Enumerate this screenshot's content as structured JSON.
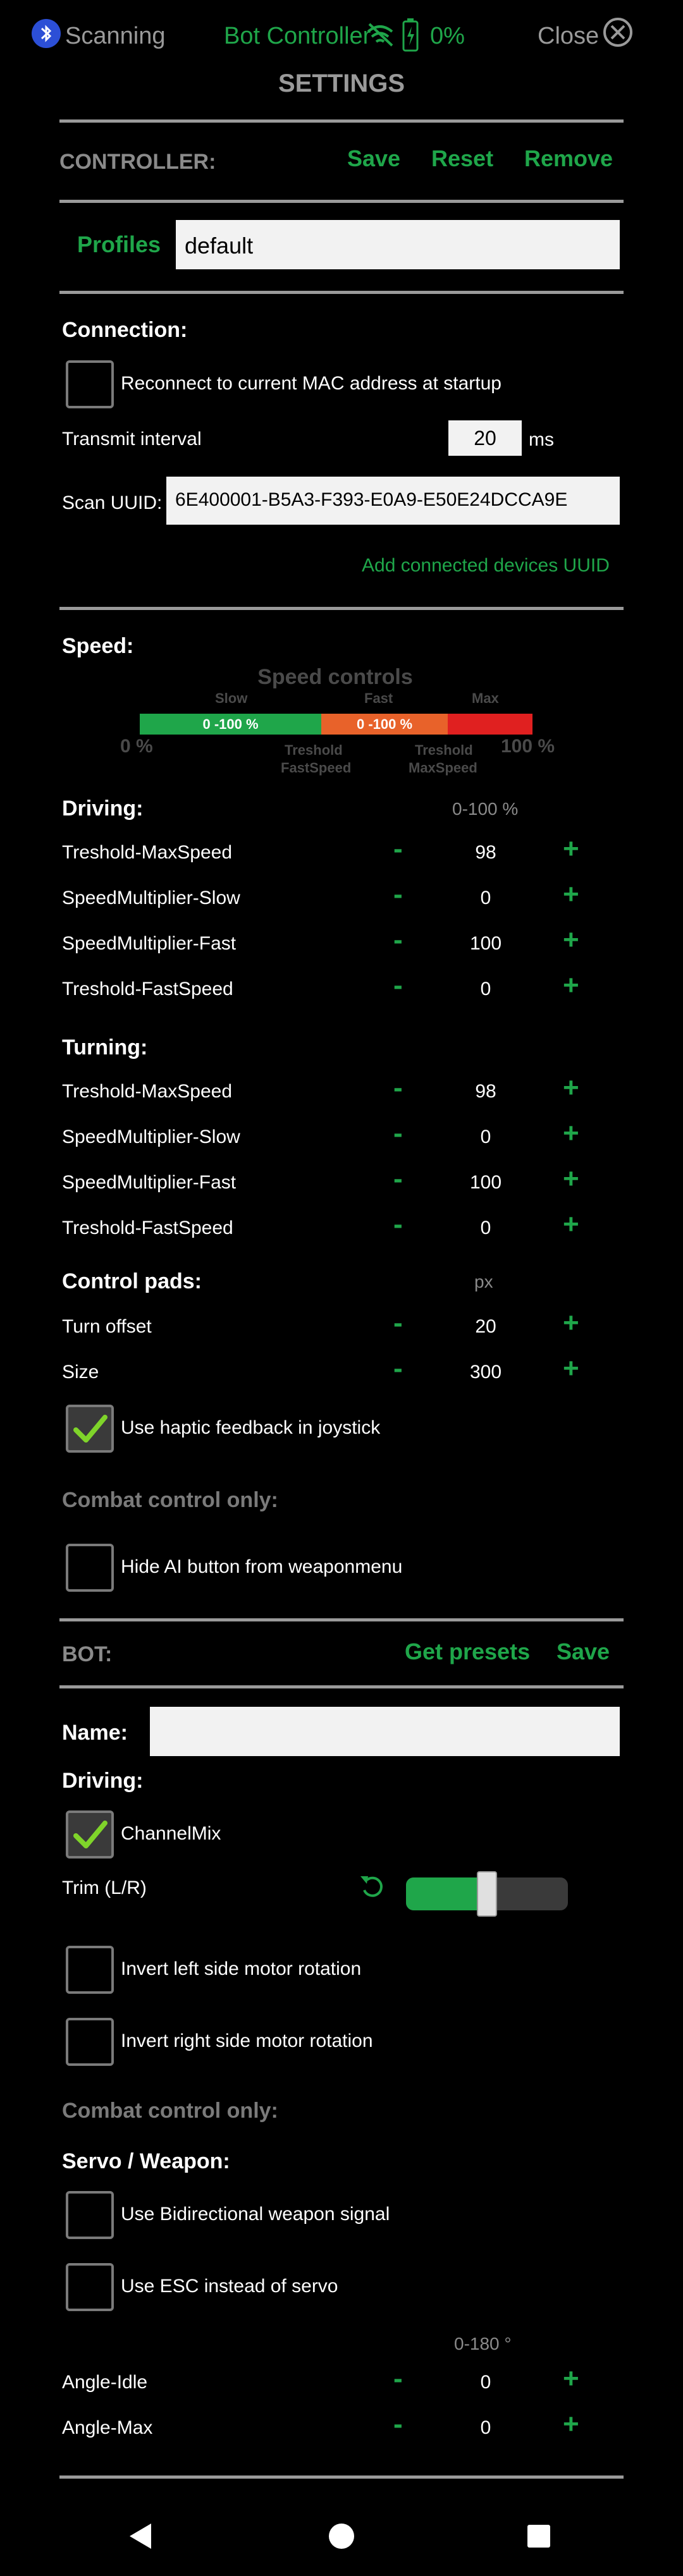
{
  "status_bar": {
    "scanning_label": "Scanning",
    "app_title": "Bot Controller",
    "battery_percent": "0%",
    "close_label": "Close"
  },
  "page_title": "SETTINGS",
  "controller": {
    "title": "CONTROLLER:",
    "save_label": "Save",
    "reset_label": "Reset",
    "remove_label": "Remove",
    "profiles_label": "Profiles",
    "profile_value": "default"
  },
  "connection": {
    "title": "Connection:",
    "reconnect_label": "Reconnect to current MAC address at startup",
    "reconnect_checked": false,
    "transmit_label": "Transmit interval",
    "transmit_value": "20",
    "transmit_unit": "ms",
    "scan_uuid_label": "Scan UUID:",
    "scan_uuid_value": "6E400001-B5A3-F393-E0A9-E50E24DCCA9E",
    "add_uuid_label": "Add connected devices UUID"
  },
  "speed": {
    "title": "Speed:",
    "diagram": {
      "title": "Speed controls",
      "slow_label": "Slow",
      "fast_label": "Fast",
      "max_label": "Max",
      "slow_range": "0 -100 %",
      "fast_range": "0 -100 %",
      "left_pct": "0 %",
      "right_pct": "100 %",
      "threshold_fast_1": "Treshold",
      "threshold_fast_2": "FastSpeed",
      "threshold_max_1": "Treshold",
      "threshold_max_2": "MaxSpeed",
      "colors": {
        "slow": "#1fa64a",
        "fast": "#e8622a",
        "max": "#e02020"
      }
    }
  },
  "driving": {
    "title": "Driving:",
    "unit": "0-100 %",
    "rows": [
      {
        "label": "Treshold-MaxSpeed",
        "value": "98"
      },
      {
        "label": "SpeedMultiplier-Slow",
        "value": "0"
      },
      {
        "label": "SpeedMultiplier-Fast",
        "value": "100"
      },
      {
        "label": "Treshold-FastSpeed",
        "value": "0"
      }
    ]
  },
  "turning": {
    "title": "Turning:",
    "rows": [
      {
        "label": "Treshold-MaxSpeed",
        "value": "98"
      },
      {
        "label": "SpeedMultiplier-Slow",
        "value": "0"
      },
      {
        "label": "SpeedMultiplier-Fast",
        "value": "100"
      },
      {
        "label": "Treshold-FastSpeed",
        "value": "0"
      }
    ]
  },
  "control_pads": {
    "title": "Control pads:",
    "unit": "px",
    "rows": [
      {
        "label": "Turn offset",
        "value": "20"
      },
      {
        "label": "Size",
        "value": "300"
      }
    ],
    "haptic_label": "Use haptic feedback in joystick",
    "haptic_checked": true
  },
  "combat1": {
    "title": "Combat control only:",
    "hide_ai_label": "Hide AI button from weaponmenu",
    "hide_ai_checked": false
  },
  "bot": {
    "title": "BOT:",
    "get_presets_label": "Get presets",
    "save_label": "Save",
    "name_label": "Name:",
    "name_value": "",
    "driving_title": "Driving:",
    "channelmix_label": "ChannelMix",
    "channelmix_checked": true,
    "trim_label": "Trim (L/R)",
    "trim_level": 0.5,
    "invert_left_label": "Invert left side motor rotation",
    "invert_right_label": "Invert right side motor rotation"
  },
  "combat2": {
    "title": "Combat control only:",
    "servo_title": "Servo / Weapon:",
    "bidirectional_label": "Use Bidirectional weapon signal",
    "esc_label": "Use ESC instead of servo",
    "unit": "0-180 °",
    "rows": [
      {
        "label": "Angle-Idle",
        "value": "0"
      },
      {
        "label": "Angle-Max",
        "value": "0"
      }
    ]
  },
  "minus": "-",
  "plus": "+",
  "icons": {
    "bluetooth": "bluetooth-icon",
    "no_wifi": "wifi-off-icon",
    "battery": "battery-icon",
    "close": "close-icon",
    "check": "check-icon",
    "reset": "undo-icon",
    "nav_back": "back-triangle-icon",
    "nav_home": "home-circle-icon",
    "nav_recents": "recents-square-icon"
  }
}
